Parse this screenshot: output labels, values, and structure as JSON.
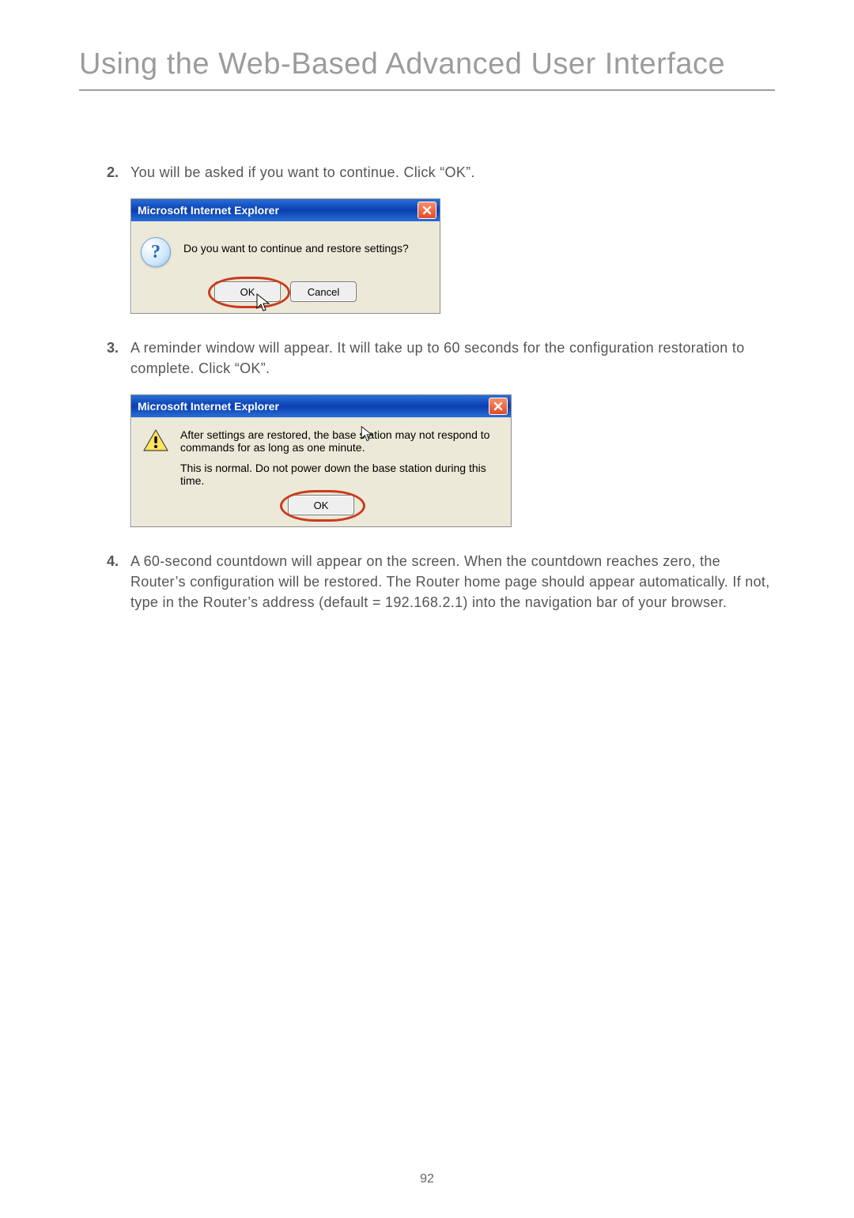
{
  "page": {
    "title": "Using the Web-Based Advanced User Interface",
    "number": "92"
  },
  "steps": {
    "s2": {
      "num": "2.",
      "text": "You will be asked if you want to continue. Click “OK”."
    },
    "s3": {
      "num": "3.",
      "text": "A reminder window will appear. It will take up to 60 seconds for the configuration restoration to complete. Click “OK”."
    },
    "s4": {
      "num": "4.",
      "text": "A 60-second countdown will appear on the screen. When the countdown reaches zero, the Router’s configuration will be restored. The Router home page should appear automatically. If not, type in the Router’s address (default = 192.168.2.1) into the navigation bar of your browser."
    }
  },
  "dialog1": {
    "title": "Microsoft Internet Explorer",
    "message": "Do you want to continue and restore settings?",
    "ok": "OK",
    "cancel": "Cancel"
  },
  "dialog2": {
    "title": "Microsoft Internet Explorer",
    "line1": "After settings are restored, the base station may not respond to commands for as long as one minute.",
    "line2": "This is normal. Do not power down the base station during this time.",
    "ok": "OK"
  }
}
